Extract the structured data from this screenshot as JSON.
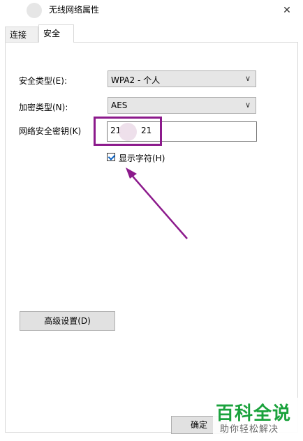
{
  "window": {
    "title": "无线网络属性",
    "close_glyph": "✕"
  },
  "tabs": [
    {
      "label": "连接",
      "active": false
    },
    {
      "label": "安全",
      "active": true
    }
  ],
  "form": {
    "security_type": {
      "label": "安全类型(E):",
      "value": "WPA2 - 个人"
    },
    "encryption_type": {
      "label": "加密类型(N):",
      "value": "AES"
    },
    "network_key": {
      "label": "网络安全密钥(K)",
      "value_start": "21",
      "value_end": "21"
    },
    "show_characters": {
      "label": "显示字符(H)",
      "checked": true
    }
  },
  "buttons": {
    "advanced": "高级设置(D)",
    "ok": "确定"
  },
  "annotation": {
    "color": "#8c1a8c"
  },
  "watermark": {
    "main": "百科全说",
    "sub": "助你轻松解决",
    "color": "#1aa23c"
  }
}
